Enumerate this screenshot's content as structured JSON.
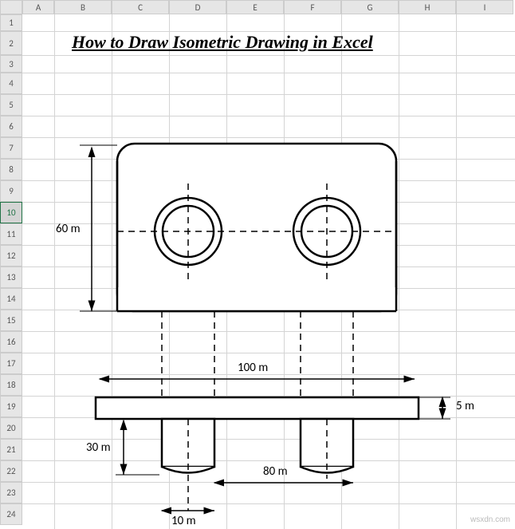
{
  "columns": [
    "A",
    "B",
    "C",
    "D",
    "E",
    "F",
    "G",
    "H",
    "I"
  ],
  "rows": [
    "1",
    "2",
    "3",
    "4",
    "5",
    "6",
    "7",
    "8",
    "9",
    "10",
    "11",
    "12",
    "13",
    "14",
    "15",
    "16",
    "17",
    "18",
    "19",
    "20",
    "21",
    "22",
    "23",
    "24"
  ],
  "selected_row_index": 9,
  "title": "How to Draw Isometric Drawing in Excel",
  "dimensions": {
    "height_60": "60 m",
    "width_100": "100 m",
    "height_5": "5 m",
    "height_30": "30 m",
    "width_80": "80 m",
    "width_left": "10 m"
  },
  "watermark": "wsxdn.com"
}
